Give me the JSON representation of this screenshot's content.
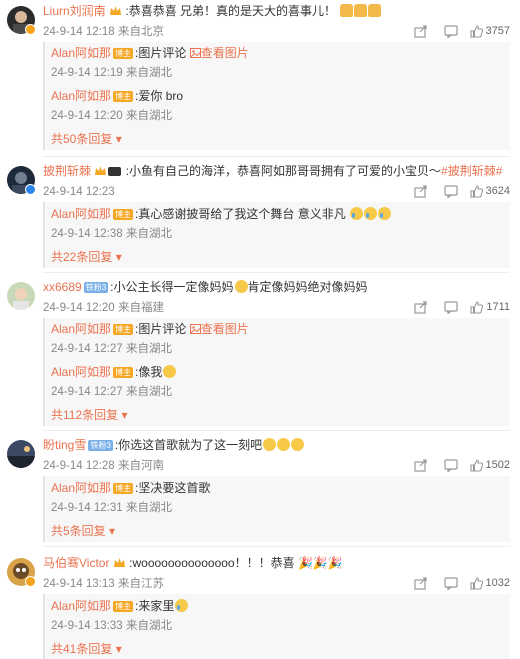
{
  "colors": {
    "username": "#eb7350",
    "text": "#333333",
    "meta": "#888888",
    "reply_bg": "#f7f7f7"
  },
  "icons": {
    "forward": "share-square-icon",
    "comment": "comment-bubble-icon",
    "like": "thumbs-up-icon"
  },
  "comments": [
    {
      "user": "Liurn刘润南",
      "text": ":恭喜恭喜 兄弟！真的是天大的喜事儿！",
      "emoji_count": 3,
      "time": "24-9-14 12:18",
      "location": "来自北京",
      "likes": "3757",
      "replies": [
        {
          "user": "Alan阿如那",
          "badge": "博主",
          "text": ":图片评论",
          "link": "查看图片",
          "time": "24-9-14 12:19",
          "location": "来自湖北"
        },
        {
          "user": "Alan阿如那",
          "badge": "博主",
          "text": ":爱你 bro",
          "time": "24-9-14 12:20",
          "location": "来自湖北"
        }
      ],
      "more": "共50条回复"
    },
    {
      "user": "披荆斩棘",
      "text": ":小鱼有自己的海洋，恭喜阿如那哥哥拥有了可爱的小宝贝～",
      "tag": "#披荆斩棘#",
      "time": "24-9-14 12:23",
      "location": "",
      "likes": "3624",
      "replies": [
        {
          "user": "Alan阿如那",
          "badge": "博主",
          "text": ":真心感谢披哥给了我这个舞台 意义非凡",
          "time": "24-9-14 12:38",
          "location": "来自湖北"
        }
      ],
      "more": "共22条回复"
    },
    {
      "user": "xx6689",
      "user_badge": "铁粉3",
      "text": ":小公主长得一定像妈妈",
      "text2": "肯定像妈妈绝对像妈妈",
      "time": "24-9-14 12:20",
      "location": "来自福建",
      "likes": "1711",
      "replies": [
        {
          "user": "Alan阿如那",
          "badge": "博主",
          "text": ":图片评论",
          "link": "查看图片",
          "time": "24-9-14 12:27",
          "location": "来自湖北"
        },
        {
          "user": "Alan阿如那",
          "badge": "博主",
          "text": ":像我",
          "time": "24-9-14 12:27",
          "location": "来自湖北"
        }
      ],
      "more": "共112条回复"
    },
    {
      "user": "盼ting雪",
      "user_badge": "铁粉3",
      "text": ":你选这首歌就为了这一刻吧",
      "time": "24-9-14 12:28",
      "location": "来自河南",
      "likes": "1502",
      "replies": [
        {
          "user": "Alan阿如那",
          "badge": "博主",
          "text": ":坚决要这首歌",
          "time": "24-9-14 12:31",
          "location": "来自湖北"
        }
      ],
      "more": "共5条回复"
    },
    {
      "user": "马伯骞Victor",
      "text": ":woooooooooooooo！！！恭喜",
      "time": "24-9-14 13:13",
      "location": "来自江苏",
      "likes": "1032",
      "replies": [
        {
          "user": "Alan阿如那",
          "badge": "博主",
          "text": ":来家里",
          "time": "24-9-14 13:33",
          "location": "来自湖北"
        }
      ],
      "more": "共41条回复"
    }
  ]
}
